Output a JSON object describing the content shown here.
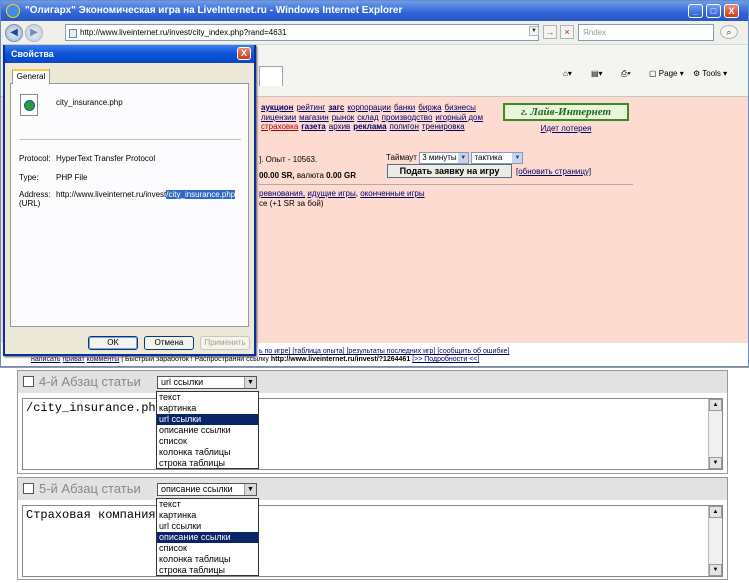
{
  "window": {
    "title": "\"Олигарх\" Экономическая игра на LiveInternet.ru - Windows Internet Explorer",
    "minimize": "_",
    "maximize": "□",
    "close": "X"
  },
  "address": {
    "url": "http://www.liveinternet.ru/invest/city_index.php?rand=4631",
    "search_placeholder": "Яndex",
    "go": "→",
    "stop": "×"
  },
  "commandbar": {
    "page": "Page",
    "tools": "Tools"
  },
  "page": {
    "menu_row1": [
      "аукцион",
      "рейтинг",
      "загс",
      "корпорации",
      "банки",
      "биржа",
      "бизнесы"
    ],
    "menu_row2": [
      "лицензии",
      "магазин",
      "рынок",
      "склад",
      "производство",
      "игорный дом"
    ],
    "menu_row3": [
      "страховка",
      "газета",
      "архив",
      "реклама",
      "полигон",
      "тренировка"
    ],
    "banner": "г. Лайв-Интернет",
    "banner_sub": "Идет лотерея",
    "experience": "]. Опыт - 10563.",
    "money": "00.00 SR,",
    "currency_label": "валюта",
    "currency_value": "0.00 GR",
    "timeout_label": "Таймаут",
    "timeout_value": "3 минуты",
    "tactic_value": "тактика",
    "apply_button": "Подать заявку на игру",
    "refresh": "[обновить страницу]",
    "games_prefix": "ревнования,",
    "games_ongoing": "идущие игры",
    "games_sep": ",",
    "games_finished": "оконченные игры",
    "bonus": "се (+1 SR за бой)",
    "footer_links": "ь по игре] [таблица опыта] [результаты последних игр] [сообщить об ошибке]",
    "footer_left1": "написать",
    "footer_left2": "приват",
    "footer_left3": "комменты",
    "footer_text": "| Быстрый заработок ! Распространяй ссылку",
    "footer_ref": "http://www.liveinternet.ru/invest/?1264461",
    "footer_more": "[>> Подробности <<]"
  },
  "dialog": {
    "title": "Свойства",
    "close": "X",
    "tab": "General",
    "filename": "city_insurance.php",
    "protocol_label": "Protocol:",
    "protocol_value": "HyperText Transfer Protocol",
    "type_label": "Type:",
    "type_value": "PHP File",
    "address_label": "Address:",
    "address_label2": "(URL)",
    "address_prefix": "http://www.liveinternet.ru/invest",
    "address_selected": "/city_insurance.php",
    "ok": "OK",
    "cancel": "Отмена",
    "apply": "Применить"
  },
  "blocks": [
    {
      "title": "4-й Абзац статьи",
      "selected": "url ссылки",
      "text": "/city_insurance.php",
      "options": [
        "текст",
        "картинка",
        "url ссылки",
        "описание ссылки",
        "список",
        "колонка таблицы",
        "строка таблицы"
      ]
    },
    {
      "title": "5-й Абзац статьи",
      "selected": "описание ссылки",
      "text": "Страховая компания",
      "options": [
        "текст",
        "картинка",
        "url ссылки",
        "описание ссылки",
        "список",
        "колонка таблицы",
        "строка таблицы"
      ]
    }
  ],
  "icons": [
    "ie-icon",
    "back-icon",
    "forward-icon",
    "refresh-icon",
    "stop-icon",
    "search-icon",
    "home-icon",
    "rss-icon",
    "print-icon",
    "page-icon",
    "tools-icon",
    "file-icon",
    "checkbox-icon",
    "dropdown-arrow-icon",
    "scroll-up-icon",
    "scroll-down-icon"
  ]
}
